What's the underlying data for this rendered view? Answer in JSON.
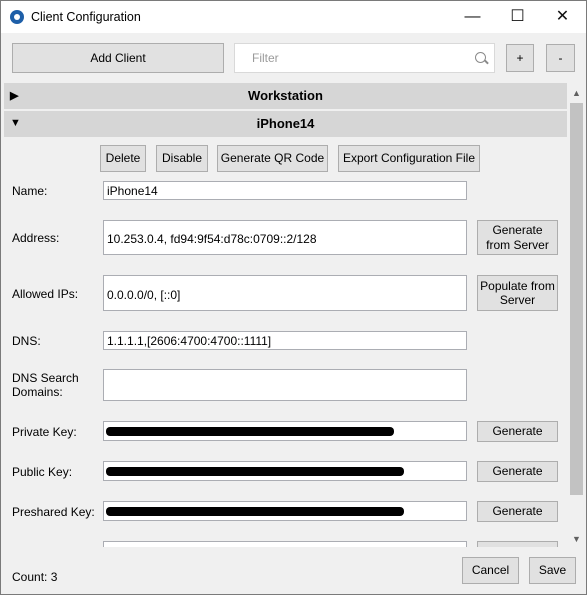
{
  "window": {
    "title": "Client Configuration",
    "minimize_glyph": "—",
    "maximize_glyph": "☐",
    "close_glyph": "✕"
  },
  "toolbar": {
    "add_client_label": "Add Client",
    "filter_placeholder": "Filter",
    "plus_label": "+",
    "minus_label": "-"
  },
  "sections": [
    {
      "title": "Workstation",
      "expanded": false,
      "triangle": "▶"
    },
    {
      "title": "iPhone14",
      "expanded": true,
      "triangle": "▼"
    }
  ],
  "actions": {
    "delete": "Delete",
    "disable": "Disable",
    "qr": "Generate QR Code",
    "export": "Export Configuration File"
  },
  "form": {
    "name_label": "Name:",
    "name_value": "iPhone14",
    "address_label": "Address:",
    "address_value": "10.253.0.4, fd94:9f54:d78c:0709::2/128",
    "address_button": "Generate from Server",
    "allowed_ips_label": "Allowed IPs:",
    "allowed_ips_value": "0.0.0.0/0, [::0]",
    "allowed_ips_button": "Populate from Server",
    "dns_label": "DNS:",
    "dns_value": "1.1.1.1,[2606:4700:4700::1111]",
    "dns_search_label": "DNS Search Domains:",
    "dns_search_value": "",
    "private_key_label": "Private Key:",
    "public_key_label": "Public Key:",
    "preshared_key_label": "Preshared Key:",
    "generate_label": "Generate"
  },
  "footer": {
    "count_text": "Count: 3",
    "cancel_label": "Cancel",
    "save_label": "Save"
  }
}
